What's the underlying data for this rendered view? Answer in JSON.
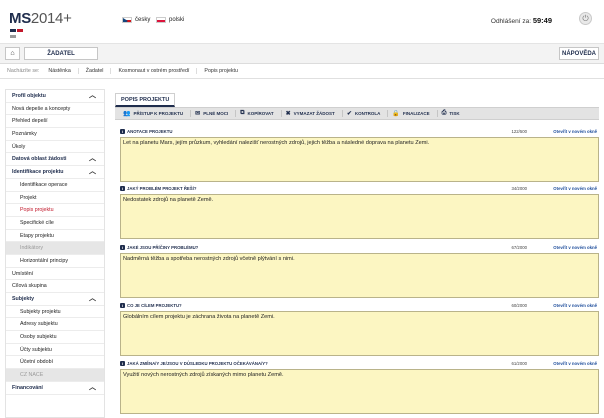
{
  "header": {
    "logo_main": "MS",
    "logo_num": "2014+",
    "lang_cz": "česky",
    "lang_pl": "polski",
    "logout_label": "Odhlášení za:",
    "logout_time": "59:49"
  },
  "toolbar": {
    "zadatel": "ŽADATEL",
    "help": "NÁPOVĚDA"
  },
  "breadcrumb": {
    "label": "Nacházíte se:",
    "items": [
      "Nástěnka",
      "Žadatel",
      "Kosmonaut v ostrém prostředí",
      "Popis projektu"
    ]
  },
  "sidebar": {
    "items": [
      {
        "label": "Profil objektu"
      },
      {
        "label": "Nová depeše a koncepty"
      },
      {
        "label": "Přehled depeší"
      },
      {
        "label": "Poznámky"
      },
      {
        "label": "Úkoly"
      },
      {
        "label": "Datová oblast žádosti"
      },
      {
        "label": "Identifikace projektu"
      },
      {
        "label": "Identifikace operace"
      },
      {
        "label": "Projekt"
      },
      {
        "label": "Popis projektu"
      },
      {
        "label": "Specifické cíle"
      },
      {
        "label": "Etapy projektu"
      },
      {
        "label": "Indikátory"
      },
      {
        "label": "Horizontální principy"
      },
      {
        "label": "Umístění"
      },
      {
        "label": "Cílová skupina"
      },
      {
        "label": "Subjekty"
      },
      {
        "label": "Subjekty projektu"
      },
      {
        "label": "Adresy subjektu"
      },
      {
        "label": "Osoby subjektu"
      },
      {
        "label": "Účty subjektu"
      },
      {
        "label": "Účetní období"
      },
      {
        "label": "CZ NACE"
      },
      {
        "label": "Financování"
      }
    ]
  },
  "main": {
    "tab": "POPIS PROJEKTU",
    "actions": [
      "PŘÍSTUP K PROJEKTU",
      "PLNÉ MOCI",
      "KOPÍROVAT",
      "VYMAZAT ŽÁDOST",
      "KONTROLA",
      "FINALIZACE",
      "TISK"
    ],
    "open_label": "Otevřít v novém okně",
    "fields": [
      {
        "title": "ANOTACE PROJEKTU",
        "count": "122/500",
        "text": "Let na planetu Mars, jejím průzkum, vyhledání nalezišť nerostných zdrojů, jejich těžba a následné doprava na planetu Zemi."
      },
      {
        "title": "JAKÝ PROBLÉM PROJEKT ŘEŠÍ?",
        "count": "34/2000",
        "text": "Nedostatek zdrojů na planetě Země."
      },
      {
        "title": "JAKÉ JSOU PŘÍČINY PROBLÉMU?",
        "count": "67/2000",
        "text": "Nadměrná těžba a spotřeba nerostných zdrojů včetně plýtvání s nimi."
      },
      {
        "title": "CO JE CÍLEM PROJEKTU?",
        "count": "60/2000",
        "text": "Globálním cílem projektu je záchrana života na planetě Zemi."
      },
      {
        "title": "JAKÁ ZMĚNA/Y JE/JSOU V DŮSLEDKU PROJEKTU OČEKÁVÁNA/Y?",
        "count": "61/2000",
        "text": "Využití nových nerostných zdrojů získaných mimo planetu Země."
      }
    ]
  },
  "colors": {
    "brand": "#1f2d4d",
    "active": "#c2182b",
    "field_bg": "#fcf6c2"
  }
}
